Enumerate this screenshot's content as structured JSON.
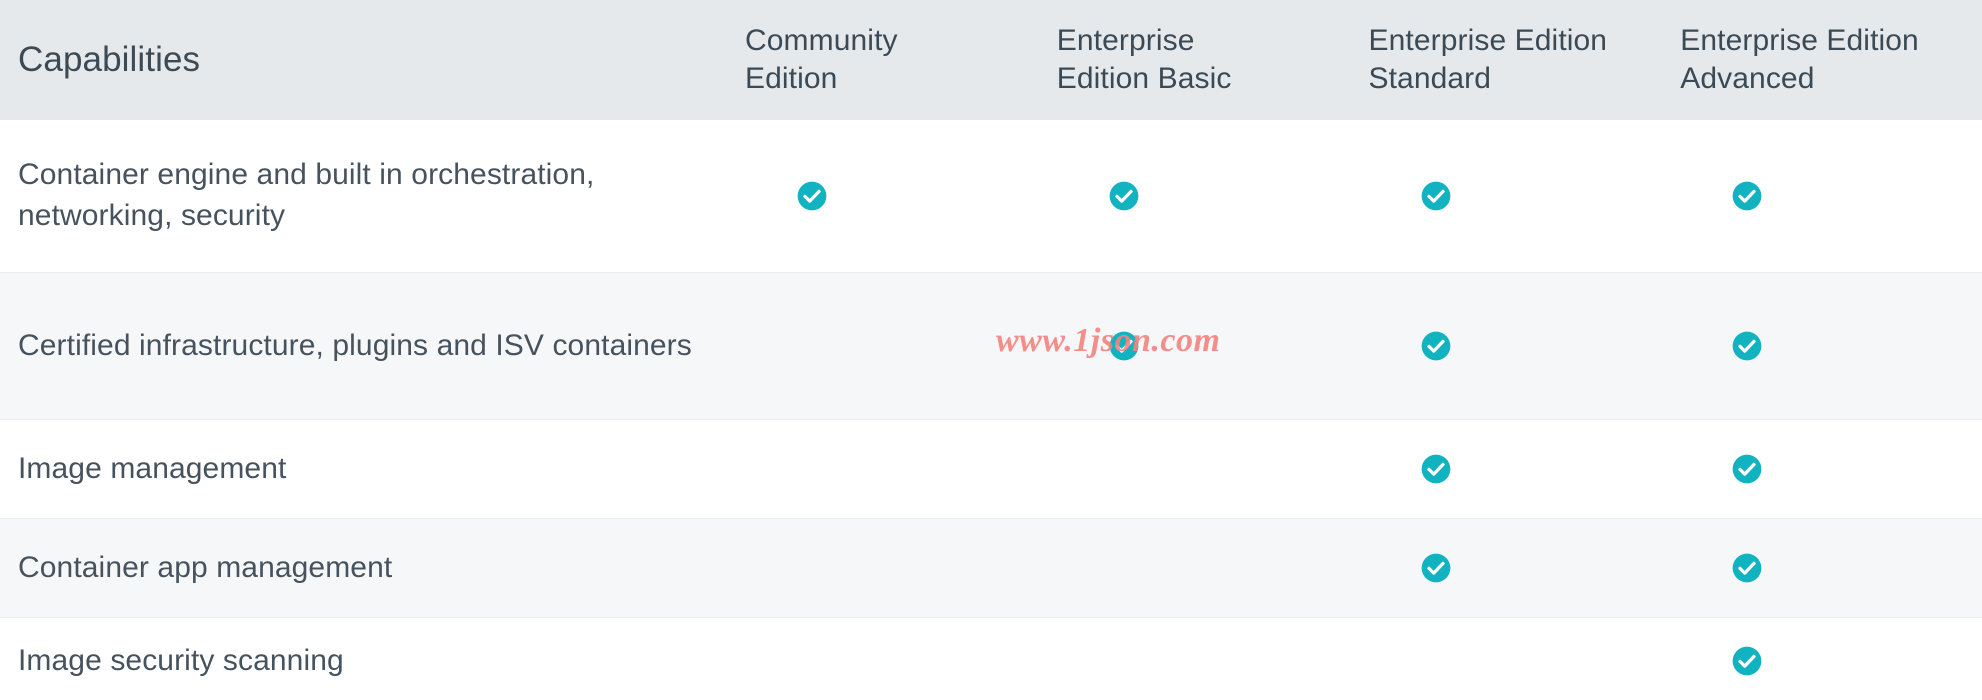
{
  "table": {
    "header": {
      "capabilities_label": "Capabilities",
      "columns": [
        {
          "id": "community-edition",
          "line1": "Community",
          "line2": "Edition"
        },
        {
          "id": "enterprise-edition-basic",
          "line1": "Enterprise",
          "line2": "Edition Basic"
        },
        {
          "id": "enterprise-edition-standard",
          "line1": "Enterprise Edition",
          "line2": "Standard"
        },
        {
          "id": "enterprise-edition-advanced",
          "line1": "Enterprise Edition",
          "line2": "Advanced"
        }
      ]
    },
    "rows": [
      {
        "label": "Container engine and built in orchestration, networking, security",
        "values": [
          "check-circle-icon",
          "check-circle-icon",
          "check-circle-icon",
          "check-circle-icon"
        ]
      },
      {
        "label": "Certified infrastructure, plugins and ISV containers",
        "values": [
          "",
          "check-circle-icon",
          "check-circle-icon",
          "check-circle-icon"
        ]
      },
      {
        "label": "Image management",
        "values": [
          "",
          "",
          "check-circle-icon",
          "check-circle-icon"
        ]
      },
      {
        "label": "Container app management",
        "values": [
          "",
          "",
          "check-circle-icon",
          "check-circle-icon"
        ]
      },
      {
        "label": "Image security scanning",
        "values": [
          "",
          "",
          "",
          "check-circle-icon"
        ]
      }
    ]
  },
  "watermark": {
    "text": "www.1json.com",
    "color": "#f4837f"
  },
  "colors": {
    "header_background": "#e5e9eb",
    "row_background": "#ffffff",
    "row_background_alt": "#f6f7f8",
    "text": "#46535f",
    "header_text": "#3c4a56",
    "check_accent": "#12b3c0",
    "row_divider": "#ececee"
  }
}
